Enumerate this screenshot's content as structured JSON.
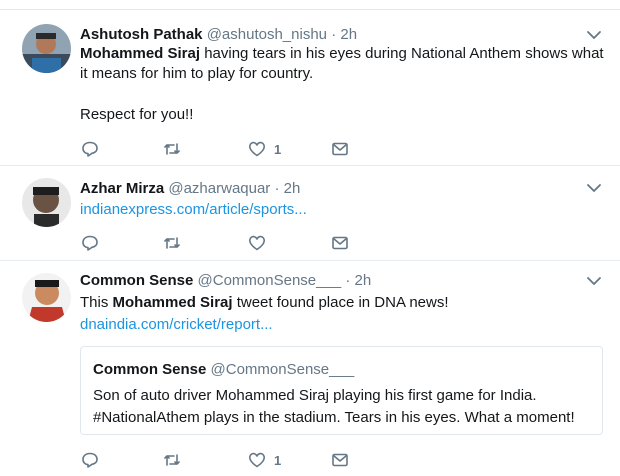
{
  "tweets": [
    {
      "name": "Ashutosh Pathak",
      "handle": "@ashutosh_nishu",
      "sep": "·",
      "time": "2h",
      "text_bold": "Mohammed Siraj",
      "text_rest": " having tears in his eyes during National Anthem shows what it means for him to play for country.",
      "text_line2": "Respect for you!!",
      "like_count": "1"
    },
    {
      "name": "Azhar Mirza",
      "handle": "@azharwaquar",
      "sep": "·",
      "time": "2h",
      "link": "indianexpress.com/article/sports...",
      "like_count": ""
    },
    {
      "name": "Common Sense",
      "handle": "@CommonSense___",
      "sep": "·",
      "time": "2h",
      "text_pre": "This ",
      "text_bold": "Mohammed Siraj",
      "text_post": " tweet found place in DNA news!",
      "link": "dnaindia.com/cricket/report...",
      "like_count": "1",
      "quote": {
        "name": "Common Sense",
        "handle": "@CommonSense___",
        "line1": "Son of auto driver Mohammed Siraj playing his first game for India.",
        "line2": "#NationalAthem plays in the stadium. Tears in his eyes. What a moment!"
      }
    }
  ],
  "colors": {
    "accent": "#1b95e0",
    "muted": "#657786",
    "border": "#e1e8ed"
  },
  "icons": [
    "reply-icon",
    "retweet-icon",
    "like-icon",
    "message-icon",
    "chevron-down-icon"
  ]
}
